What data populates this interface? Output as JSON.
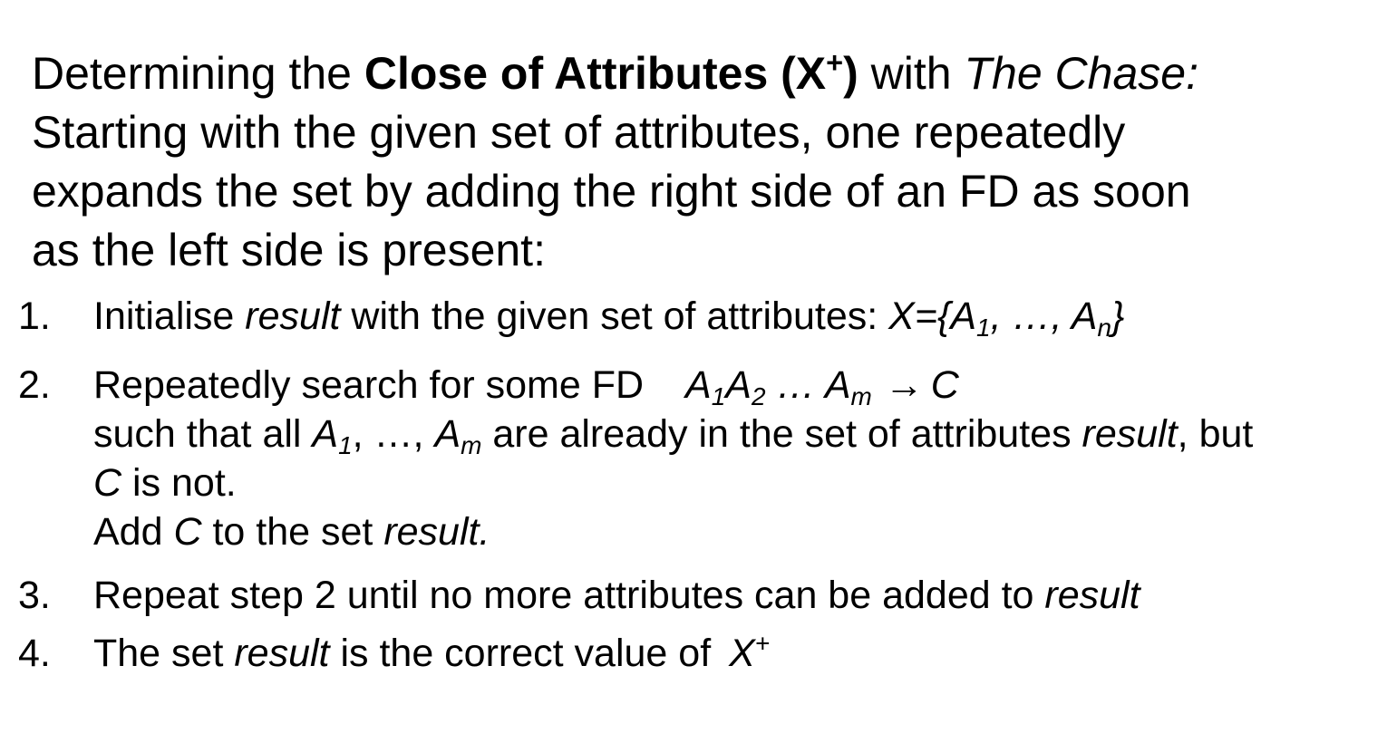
{
  "intro": {
    "p1": "Determining the ",
    "bold": "Close of Attributes (X",
    "bold_sup": "+",
    "bold_end": ")",
    "p2": " with ",
    "chase": "The Chase:",
    "line2": "Starting with the given set of attributes, one repeatedly",
    "line3": "expands the set by adding the right side of an FD as soon",
    "line4": "as the left side is present:"
  },
  "steps": [
    {
      "number": "1.",
      "t1": "Initialise ",
      "t1_it": "result",
      "t2": " with the given set of attributes: ",
      "x_expr": "X={A",
      "sub1": "1",
      "mid": ", …, A",
      "subn": "n",
      "close": "}"
    },
    {
      "number": "2.",
      "t1": "Repeatedly search for some FD",
      "fd_a1": "A",
      "fd_a1_sub": "1",
      "fd_a2": "A",
      "fd_a2_sub": "2",
      "fd_dots": " … A",
      "fd_am_sub": "m",
      "fd_arrow": "→",
      "fd_c": "C",
      "l2_t1": "such that all ",
      "l2_a1": "A",
      "l2_a1_sub": "1",
      "l2_mid": ", …, ",
      "l2_am": "A",
      "l2_am_sub": "m",
      "l2_t2": " are already in the set of attributes ",
      "l2_result": "result",
      "l2_t3": ", but",
      "l3_c": "C",
      "l3_t": " is not.",
      "l4_t1": "Add ",
      "l4_c": "C",
      "l4_t2": " to the set ",
      "l4_result": "result."
    },
    {
      "number": "3.",
      "t1": "Repeat step 2 until no more attributes can be added to ",
      "t1_it": "result"
    },
    {
      "number": "4.",
      "t1": "The set ",
      "t1_it": "result",
      "t2": " is the correct value of ",
      "x": "X",
      "x_sup": "+"
    }
  ]
}
